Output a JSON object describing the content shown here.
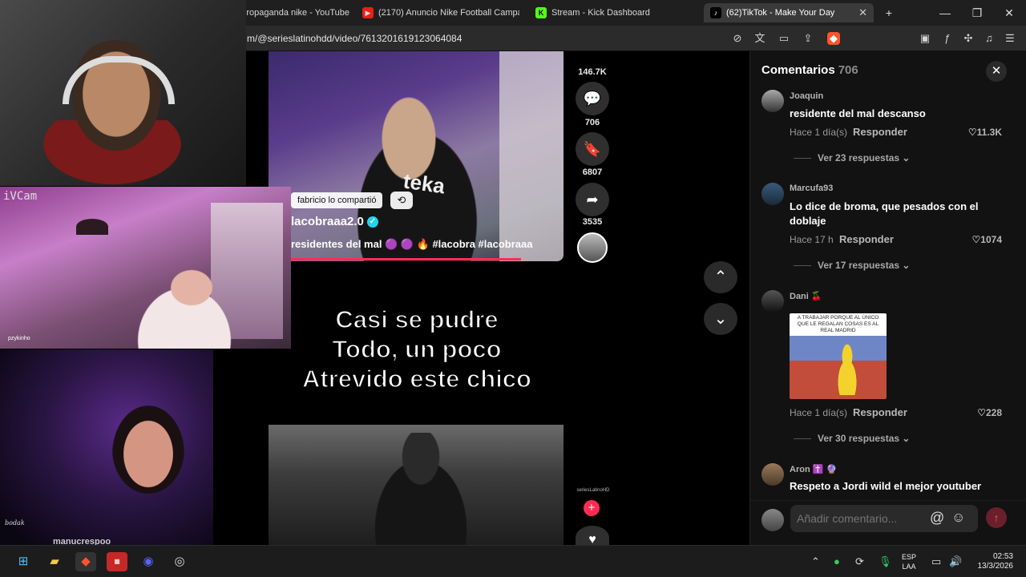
{
  "tabs": [
    {
      "label": "Propaganda nike - YouTube",
      "icon": "youtube-icon"
    },
    {
      "label": "(2170) Anuncio Nike Football Campa",
      "icon": "youtube-icon"
    },
    {
      "label": "Stream - Kick Dashboard",
      "icon": "kick-icon"
    },
    {
      "label": "(62)TikTok - Make Your Day",
      "icon": "tiktok-icon",
      "active": true
    }
  ],
  "address": {
    "url": "m/@serieslatinohdd/video/7613201619123064084"
  },
  "video": {
    "shared_by": "fabricio lo compartió",
    "author": "lacobraaa2.0",
    "caption": "residentes del mal 🟣 🟣 🔥 #lacobra #lacobraaa",
    "overlay_line1": "Casi se pudre",
    "overlay_line2": "Todo, un poco",
    "overlay_line3": "Atrevido este chico",
    "likes": "146.7K",
    "comments": "706",
    "saves": "6807",
    "shares": "3535",
    "next_user": "seriesLatinoHD"
  },
  "comments_panel": {
    "title": "Comentarios",
    "count": "706",
    "reply_label": "Responder",
    "items": [
      {
        "user": "Joaquin",
        "text": "residente del mal descanso",
        "time": "Hace 1 día(s)",
        "likes": "11.3K",
        "more": "Ver 23 respuestas"
      },
      {
        "user": "Marcufa93",
        "text": "Lo dice de broma, que pesados con el doblaje",
        "time": "Hace 17 h",
        "likes": "1074",
        "more": "Ver 17 respuestas"
      },
      {
        "user": "Dani 🍒",
        "text": "",
        "meme_text": "A TRABAJAR PORQUE AL ÚNICO QUE LE REGALAN COSAS ES AL REAL MADRID",
        "time": "Hace 1 día(s)",
        "likes": "228",
        "more": "Ver 30 respuestas"
      },
      {
        "user": "Aron ✝️ 🔮",
        "text": "Respeto a Jordi wild el mejor youtuber"
      }
    ],
    "input_placeholder": "Añadir comentario..."
  },
  "webcams": {
    "cam2_label": "iVCam",
    "cam2_name": "pzykinho",
    "cam3_signature": "bodak",
    "cam3_user": "manucrespoo"
  },
  "taskbar": {
    "lang_line1": "ESP",
    "lang_line2": "LAA",
    "time": "02:53",
    "date": "13/3/2026"
  },
  "colors": {
    "accent": "#fe2c55",
    "panel": "#121212"
  }
}
